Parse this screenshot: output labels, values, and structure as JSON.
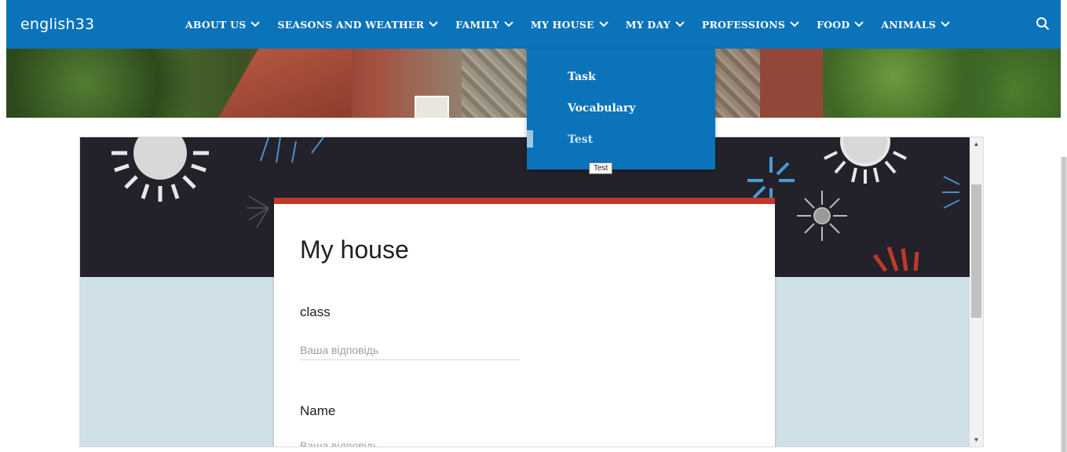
{
  "site": {
    "logo": "english33"
  },
  "nav": {
    "items": [
      {
        "label": "ABOUT US"
      },
      {
        "label": "SEASONS AND WEATHER"
      },
      {
        "label": "FAMILY"
      },
      {
        "label": "MY HOUSE"
      },
      {
        "label": "MY DAY"
      },
      {
        "label": "PROFESSIONS"
      },
      {
        "label": "FOOD"
      },
      {
        "label": "ANIMALS"
      }
    ],
    "search_icon": "search-icon"
  },
  "dropdown": {
    "parent": "MY HOUSE",
    "items": [
      {
        "label": "Task"
      },
      {
        "label": "Vocabulary"
      },
      {
        "label": "Test"
      }
    ],
    "tooltip": "Test"
  },
  "form": {
    "title": "My house",
    "questions": [
      {
        "label": "class",
        "placeholder": "Ваша відповідь"
      },
      {
        "label": "Name",
        "placeholder": "Ваша відповідь"
      }
    ]
  },
  "colors": {
    "nav_bg": "#0a73ba",
    "form_accent": "#c0392b",
    "form_bg": "#cfe0e6",
    "header_dark": "#23222a"
  }
}
